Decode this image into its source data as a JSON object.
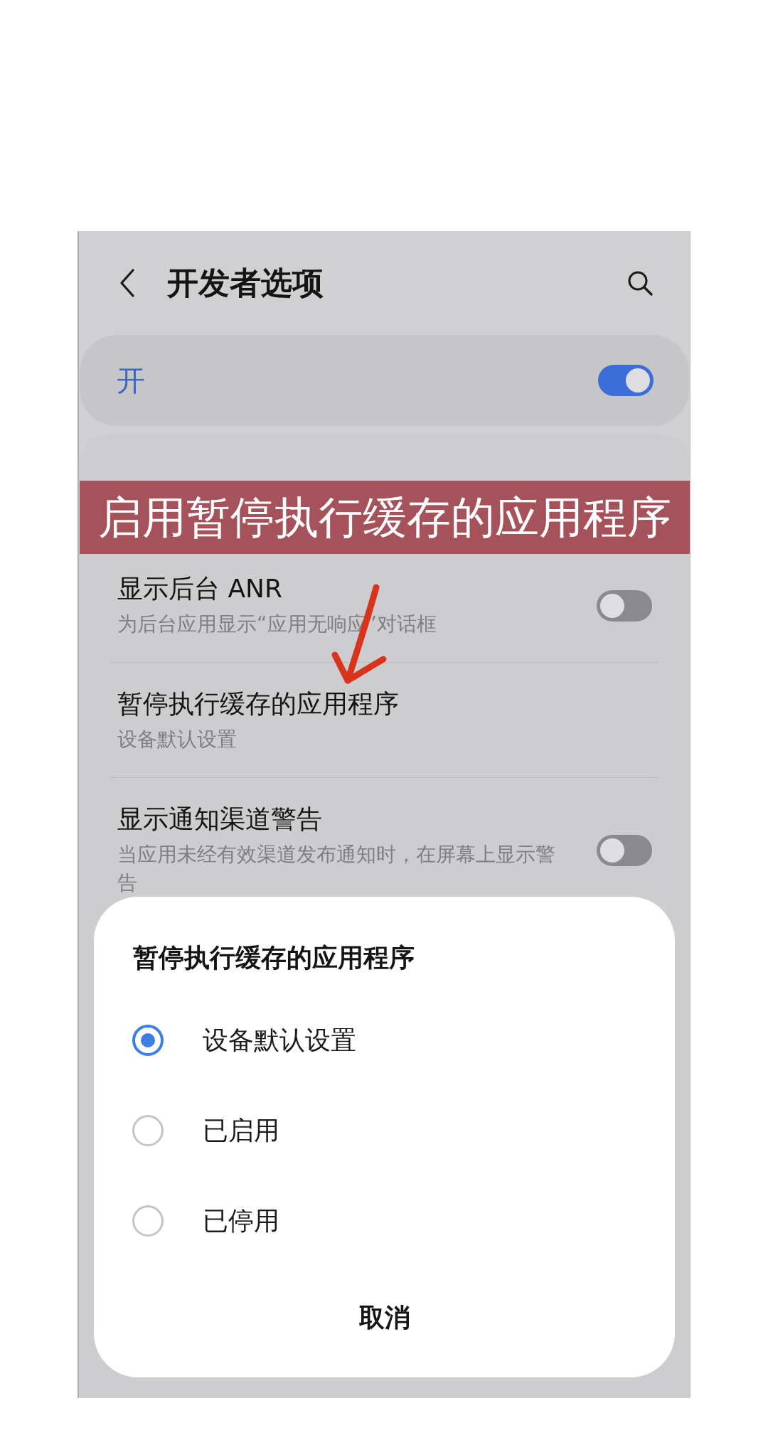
{
  "header": {
    "title": "开发者选项"
  },
  "master_switch": {
    "label": "开",
    "on": true
  },
  "settings": [
    {
      "kind": "toggle",
      "title": "显示后台 ANR",
      "subtitle": "为后台应用显示“应用无响应”对话框",
      "on": false
    },
    {
      "kind": "option",
      "title": "暂停执行缓存的应用程序",
      "subtitle": "设备默认设置"
    },
    {
      "kind": "toggle",
      "title": "显示通知渠道警告",
      "subtitle": "当应用未经有效渠道发布通知时，在屏幕上显示警告",
      "on": false
    }
  ],
  "annotation": {
    "banner": "启用暂停执行缓存的应用程序"
  },
  "dialog": {
    "title": "暂停执行缓存的应用程序",
    "options": [
      {
        "label": "设备默认设置",
        "selected": true
      },
      {
        "label": "已启用",
        "selected": false
      },
      {
        "label": "已停用",
        "selected": false
      }
    ],
    "cancel": "取消"
  }
}
